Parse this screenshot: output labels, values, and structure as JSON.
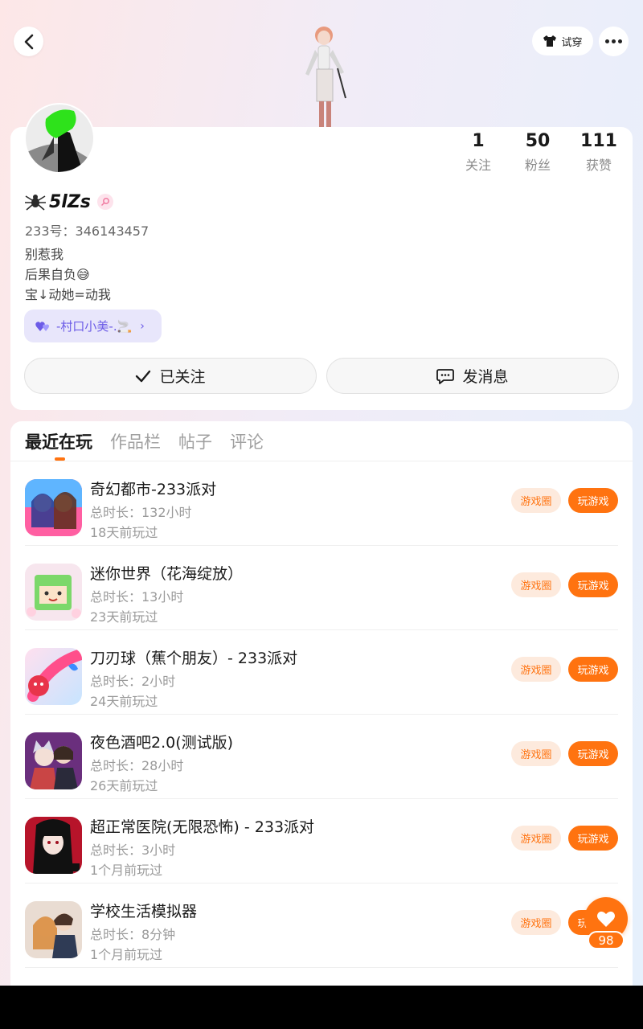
{
  "header": {
    "tryon_label": "试穿"
  },
  "profile": {
    "nickname": "5lZs",
    "uid": "233号：346143457",
    "bio": [
      "别惹我",
      "后果自负😅",
      "宝↓动她=动我"
    ],
    "cp_tag": "-村口小美-.🚬",
    "stats": [
      {
        "value": "1",
        "label": "关注"
      },
      {
        "value": "50",
        "label": "粉丝"
      },
      {
        "value": "111",
        "label": "获赞"
      }
    ],
    "follow_label": "已关注",
    "message_label": "发消息"
  },
  "tabs": [
    {
      "label": "最近在玩",
      "active": true
    },
    {
      "label": "作品栏",
      "active": false
    },
    {
      "label": "帖子",
      "active": false
    },
    {
      "label": "评论",
      "active": false
    }
  ],
  "games": [
    {
      "title": "奇幻都市-233派对",
      "time": "总时长：132小时",
      "last": "18天前玩过"
    },
    {
      "title": "迷你世界（花海绽放）",
      "time": "总时长：13小时",
      "last": "23天前玩过"
    },
    {
      "title": "刀刃球（蕉个朋友）- 233派对",
      "time": "总时长：2小时",
      "last": "24天前玩过"
    },
    {
      "title": "夜色酒吧2.0(测试版)",
      "time": "总时长：28小时",
      "last": "26天前玩过"
    },
    {
      "title": "超正常医院(无限恐怖) - 233派对",
      "time": "总时长：3小时",
      "last": "1个月前玩过"
    },
    {
      "title": "学校生活模拟器",
      "time": "总时长：8分钟",
      "last": "1个月前玩过"
    }
  ],
  "game_actions": {
    "circle_label": "游戏圈",
    "play_label": "玩游戏"
  },
  "fab": {
    "count": "98"
  },
  "colors": {
    "accent": "#ff7310",
    "accent_light": "#fdeadd",
    "cp_purple": "#6c5ce7"
  }
}
